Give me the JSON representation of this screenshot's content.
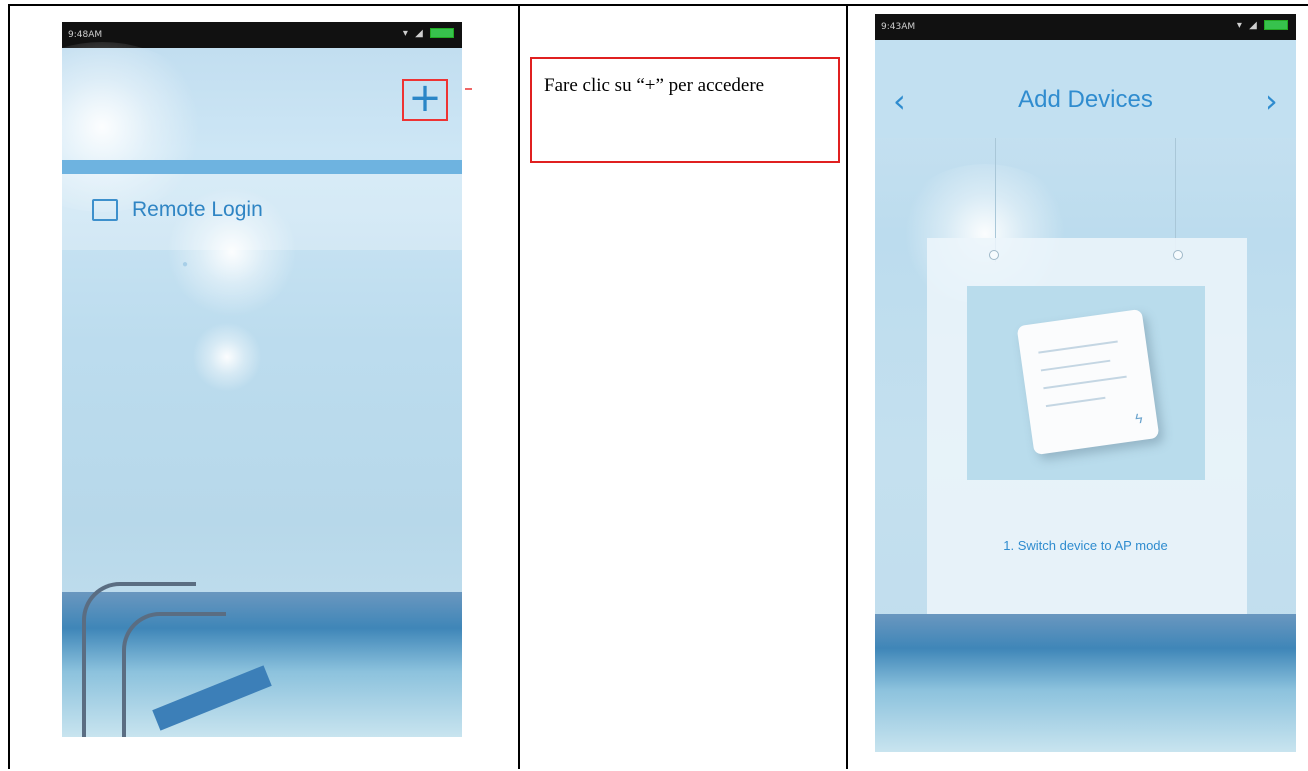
{
  "left_phone": {
    "status_time": "9:48AM",
    "plus_label": "+",
    "remote_login_label": "Remote Login"
  },
  "middle": {
    "caption": "Fare clic su “+” per accedere"
  },
  "right_phone": {
    "status_time": "9:43AM",
    "back_glyph": "‹",
    "forward_glyph": "›",
    "title": "Add Devices",
    "step_text": "1. Switch device to AP mode"
  },
  "colors": {
    "accent_blue": "#2f8ccf",
    "highlight_red": "#e02020"
  }
}
